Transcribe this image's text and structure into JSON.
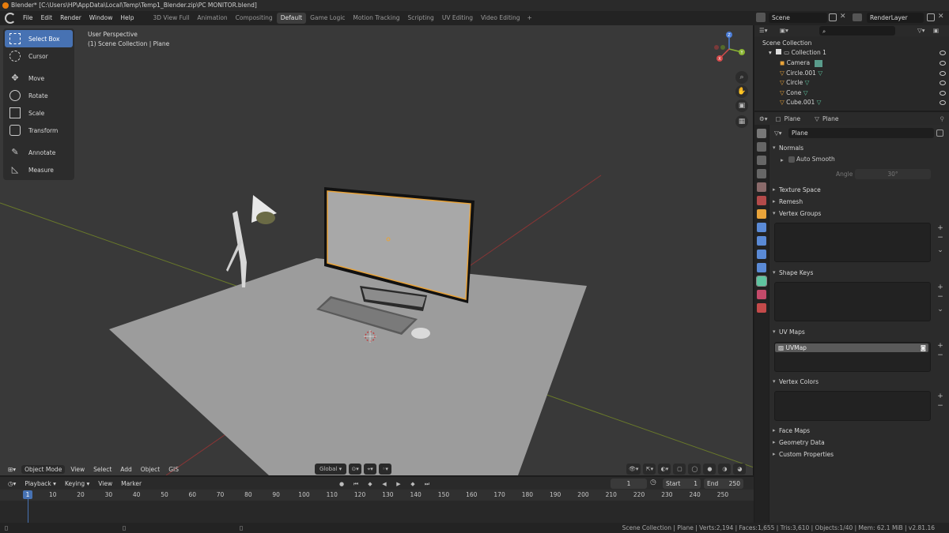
{
  "title_bar": {
    "text": "Blender* [C:\\Users\\HP\\AppData\\Local\\Temp\\Temp1_Blender.zip\\PC MONITOR.blend]"
  },
  "menu": [
    "File",
    "Edit",
    "Render",
    "Window",
    "Help"
  ],
  "workspaces": [
    "3D View Full",
    "Animation",
    "Compositing",
    "Default",
    "Game Logic",
    "Motion Tracking",
    "Scripting",
    "UV Editing",
    "Video Editing"
  ],
  "active_workspace": "Default",
  "scene": {
    "label": "Scene",
    "render_layer": "RenderLayer"
  },
  "tools": [
    "Select Box",
    "Cursor",
    "Move",
    "Rotate",
    "Scale",
    "Transform",
    "Annotate",
    "Measure"
  ],
  "viewport": {
    "perspective": "User Perspective",
    "collection_info": "(1) Scene Collection | Plane",
    "gizmo": {
      "x": "X",
      "y": "Y",
      "z": "Z"
    }
  },
  "viewport_header": {
    "mode": "Object Mode",
    "menus": [
      "View",
      "Select",
      "Add",
      "Object",
      "GIS"
    ],
    "orientation": "Global"
  },
  "timeline": {
    "menus": [
      "Playback",
      "Keying",
      "View",
      "Marker"
    ],
    "current_frame": "1",
    "start_label": "Start",
    "start_value": "1",
    "end_label": "End",
    "end_value": "250",
    "ticks": [
      "1",
      "10",
      "20",
      "30",
      "40",
      "50",
      "60",
      "70",
      "80",
      "90",
      "100",
      "110",
      "120",
      "130",
      "140",
      "150",
      "160",
      "170",
      "180",
      "190",
      "200",
      "210",
      "220",
      "230",
      "240",
      "250"
    ]
  },
  "outliner": {
    "root": "Scene Collection",
    "collection": "Collection 1",
    "items": [
      "Camera",
      "Circle.001",
      "Circle",
      "Cone",
      "Cube.001"
    ]
  },
  "properties": {
    "object": "Plane",
    "mesh": "Plane",
    "data_name": "Plane",
    "panels": {
      "normals": "Normals",
      "auto_smooth": "Auto Smooth",
      "angle_label": "Angle",
      "angle_value": "30°",
      "texture_space": "Texture Space",
      "remesh": "Remesh",
      "vertex_groups": "Vertex Groups",
      "shape_keys": "Shape Keys",
      "uv_maps": "UV Maps",
      "uv_map_item": "UVMap",
      "vertex_colors": "Vertex Colors",
      "face_maps": "Face Maps",
      "geometry_data": "Geometry Data",
      "custom_properties": "Custom Properties"
    }
  },
  "status_bar": "Scene Collection | Plane | Verts:2,194 | Faces:1,655 | Tris:3,610 | Objects:1/40 | Mem: 62.1 MiB | v2.81.16",
  "colors": {
    "accent": "#4772b3",
    "selection": "#e8a33a",
    "background": "#393939"
  }
}
